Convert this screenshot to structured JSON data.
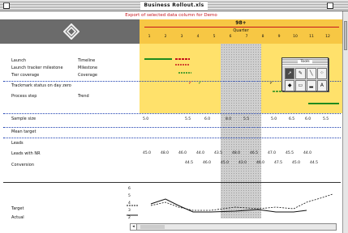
{
  "window": {
    "title": "Business Rollout.xls",
    "subtitle": "Export of selected data column for Demo"
  },
  "header": {
    "year": "98+",
    "period": "Quarter",
    "columns": [
      "1",
      "2",
      "3",
      "4",
      "5",
      "6",
      "7",
      "8",
      "9",
      "10",
      "11",
      "12"
    ]
  },
  "rows": [
    {
      "label": "Launch",
      "unit": "Timeline"
    },
    {
      "label": "Launch tracker milestone",
      "unit": "Milestone"
    },
    {
      "label": "Tier coverage",
      "unit": "Coverage"
    },
    {
      "label": "Trackmark status on day zero",
      "unit": ""
    },
    {
      "label": "Process step",
      "unit": "Trend"
    },
    {
      "label": "Sample size",
      "unit": ""
    },
    {
      "label": "Mean target",
      "unit": ""
    },
    {
      "label": "Leads",
      "unit": ""
    },
    {
      "label": "Leads with NR",
      "unit": ""
    },
    {
      "label": "Conversion",
      "unit": ""
    }
  ],
  "values": {
    "row5": [
      "5.0",
      "5.5",
      "6.0",
      "8.0",
      "5.5",
      "5.0",
      "6.5",
      "6.0",
      "5.5"
    ],
    "row8": [
      "45.0",
      "48.0",
      "46.0",
      "44.0",
      "43.5",
      "48.0",
      "46.5",
      "47.0",
      "45.5",
      "44.0"
    ],
    "row9": [
      "44.5",
      "46.0",
      "45.0",
      "43.0",
      "46.0",
      "47.5",
      "45.0",
      "44.5"
    ]
  },
  "palette": {
    "title": "Tools",
    "tools": [
      "pointer-icon",
      "pencil-icon",
      "line-icon",
      "spray-icon",
      "bucket-icon",
      "shape-icon",
      "bar-icon",
      "text-icon"
    ]
  },
  "chart": {
    "row_labels": [
      "Target",
      "Actual"
    ],
    "y_ticks": [
      "6",
      "5",
      "4",
      "3",
      "2"
    ]
  }
}
